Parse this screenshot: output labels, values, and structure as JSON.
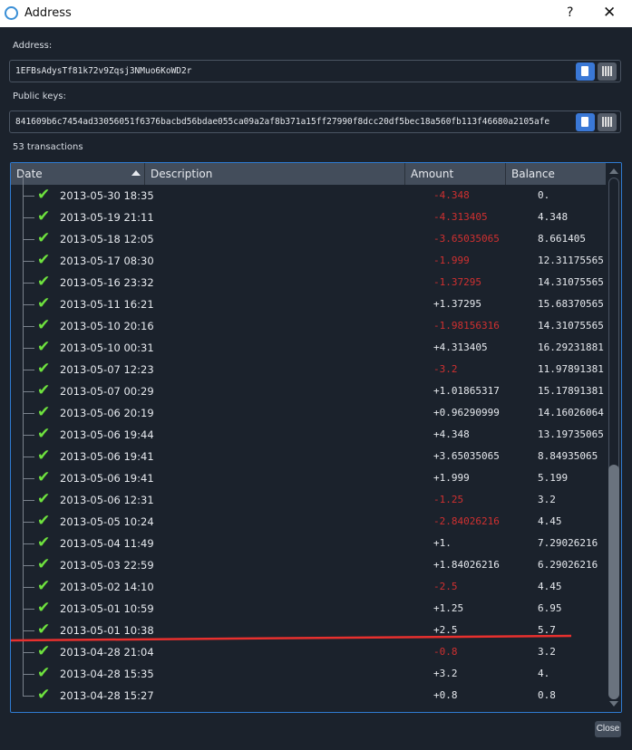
{
  "window": {
    "title": "Address",
    "help": "?",
    "close": "✕"
  },
  "address": {
    "label": "Address:",
    "value": "1EFBsAdysTf81k72v9Zqsj3NMuo6KoWD2r"
  },
  "public_keys": {
    "label": "Public keys:",
    "value": "841609b6c7454ad33056051f6376bacbd56bdae055ca09a2af8b371a15ff27990f8dcc20df5bec18a560fb113f46680a2105afe"
  },
  "tx_count": "53 transactions",
  "columns": [
    "Date",
    "Description",
    "Amount",
    "Balance"
  ],
  "sort": {
    "column": "Date",
    "direction": "ascending"
  },
  "scroll_position": {
    "visible_fraction": 0.45,
    "offset_fraction": 0.55
  },
  "colors": {
    "negative": "#d03030",
    "accent": "#2f7bd1",
    "check": "#6ee23e",
    "annotation": "#e8302e"
  },
  "rows": [
    {
      "date": "2013-05-30 18:35",
      "amount": "-4.348",
      "balance": "0."
    },
    {
      "date": "2013-05-19 21:11",
      "amount": "-4.313405",
      "balance": "4.348"
    },
    {
      "date": "2013-05-18 12:05",
      "amount": "-3.65035065",
      "balance": "8.661405"
    },
    {
      "date": "2013-05-17 08:30",
      "amount": "-1.999",
      "balance": "12.31175565"
    },
    {
      "date": "2013-05-16 23:32",
      "amount": "-1.37295",
      "balance": "14.31075565"
    },
    {
      "date": "2013-05-11 16:21",
      "amount": "+1.37295",
      "balance": "15.68370565"
    },
    {
      "date": "2013-05-10 20:16",
      "amount": "-1.98156316",
      "balance": "14.31075565"
    },
    {
      "date": "2013-05-10 00:31",
      "amount": "+4.313405",
      "balance": "16.29231881"
    },
    {
      "date": "2013-05-07 12:23",
      "amount": "-3.2",
      "balance": "11.97891381"
    },
    {
      "date": "2013-05-07 00:29",
      "amount": "+1.01865317",
      "balance": "15.17891381"
    },
    {
      "date": "2013-05-06 20:19",
      "amount": "+0.96290999",
      "balance": "14.16026064"
    },
    {
      "date": "2013-05-06 19:44",
      "amount": "+4.348",
      "balance": "13.19735065"
    },
    {
      "date": "2013-05-06 19:41",
      "amount": "+3.65035065",
      "balance": "8.84935065"
    },
    {
      "date": "2013-05-06 19:41",
      "amount": "+1.999",
      "balance": "5.199"
    },
    {
      "date": "2013-05-06 12:31",
      "amount": "-1.25",
      "balance": "3.2"
    },
    {
      "date": "2013-05-05 10:24",
      "amount": "-2.84026216",
      "balance": "4.45"
    },
    {
      "date": "2013-05-04 11:49",
      "amount": "+1.",
      "balance": "7.29026216"
    },
    {
      "date": "2013-05-03 22:59",
      "amount": "+1.84026216",
      "balance": "6.29026216"
    },
    {
      "date": "2013-05-02 14:10",
      "amount": "-2.5",
      "balance": "4.45"
    },
    {
      "date": "2013-05-01 10:59",
      "amount": "+1.25",
      "balance": "6.95"
    },
    {
      "date": "2013-05-01 10:38",
      "amount": "+2.5",
      "balance": "5.7"
    },
    {
      "date": "2013-04-28 21:04",
      "amount": "-0.8",
      "balance": "3.2"
    },
    {
      "date": "2013-04-28 15:35",
      "amount": "+3.2",
      "balance": "4."
    },
    {
      "date": "2013-04-28 15:27",
      "amount": "+0.8",
      "balance": "0.8"
    }
  ],
  "close_button": "Close"
}
